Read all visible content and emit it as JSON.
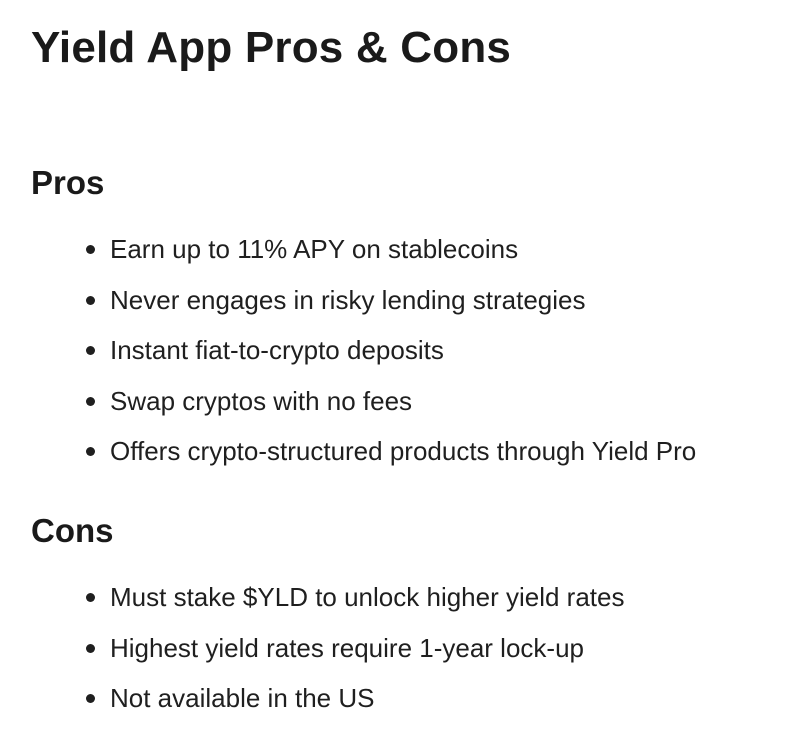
{
  "title": "Yield App Pros & Cons",
  "pros": {
    "heading": "Pros",
    "items": [
      "Earn up to 11% APY on stablecoins",
      "Never engages in risky lending strategies",
      "Instant fiat-to-crypto deposits",
      "Swap cryptos with no fees",
      "Offers crypto-structured products through Yield Pro"
    ]
  },
  "cons": {
    "heading": "Cons",
    "items": [
      "Must stake $YLD to unlock higher yield rates",
      "Highest yield rates require 1-year lock-up",
      "Not available in the US"
    ]
  }
}
